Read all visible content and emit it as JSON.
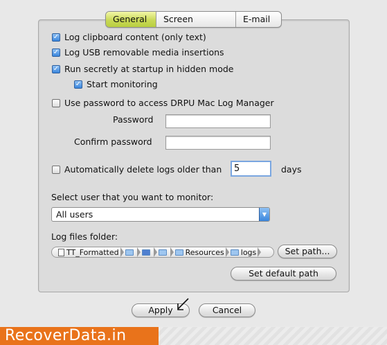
{
  "tabs": [
    {
      "label": "General",
      "active": true
    },
    {
      "label": "Screen capture",
      "active": false
    },
    {
      "label": "E-mail",
      "active": false
    }
  ],
  "options": {
    "log_clipboard": {
      "label": "Log clipboard content (only text)",
      "checked": true
    },
    "log_usb": {
      "label": "Log USB removable media insertions",
      "checked": true
    },
    "run_secretly": {
      "label": "Run secretly at startup in hidden mode",
      "checked": true
    },
    "start_monitoring": {
      "label": "Start monitoring",
      "checked": true
    },
    "use_password": {
      "label": "Use password to access DRPU Mac Log Manager",
      "checked": false
    },
    "auto_delete": {
      "label": "Automatically delete logs older than",
      "checked": false
    }
  },
  "password": {
    "label": "Password",
    "value": ""
  },
  "confirm_password": {
    "label": "Confirm password",
    "value": ""
  },
  "auto_delete_days": {
    "value": "5",
    "unit": "days"
  },
  "user_select": {
    "label": "Select user that you want to monitor:",
    "value": "All users"
  },
  "log_folder": {
    "label": "Log files folder:",
    "path_segments": [
      "TT_Formatted",
      "",
      "",
      "",
      "Resources",
      "logs"
    ],
    "set_path_label": "Set path...",
    "set_default_label": "Set default path"
  },
  "footer": {
    "apply_label": "Apply",
    "cancel_label": "Cancel"
  },
  "watermark": {
    "text": "RecoverData.in"
  },
  "colors": {
    "accent_tab": "#c9d957",
    "checkbox_blue": "#3a86dd",
    "watermark_bg": "#e9731b"
  }
}
